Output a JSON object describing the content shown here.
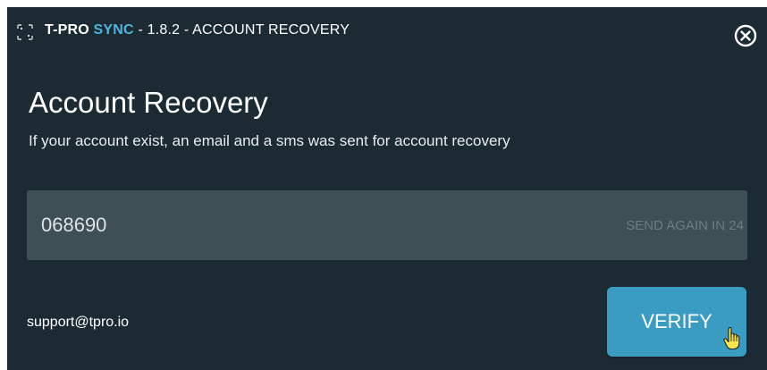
{
  "window": {
    "title_brand": "T-PRO",
    "title_sync": "SYNC",
    "title_rest": " - 1.8.2  - ACCOUNT RECOVERY"
  },
  "main": {
    "heading": "Account Recovery",
    "message": "If your account exist, an email and a sms was sent for account recovery",
    "code_value": "068690",
    "send_again": "SEND AGAIN IN 24"
  },
  "footer": {
    "support_email": "support@tpro.io",
    "verify_label": "VERIFY"
  },
  "icons": {
    "app": "app-frame-icon",
    "close": "close-circle-icon",
    "cursor": "hand-pointer-icon"
  },
  "colors": {
    "background": "#1c2a33",
    "accent": "#4fb3e0",
    "button": "#3a9cc3",
    "field": "#3e4f56"
  }
}
